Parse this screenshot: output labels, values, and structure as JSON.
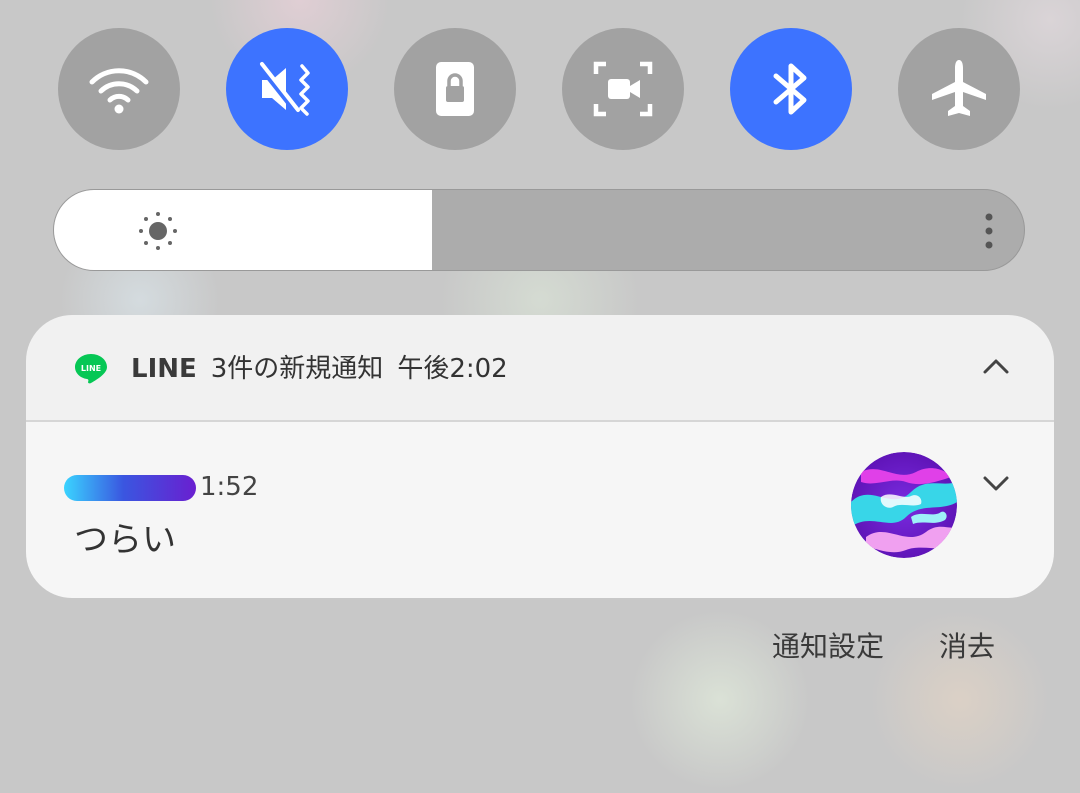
{
  "quick_settings": {
    "tiles": [
      {
        "icon": "wifi-icon",
        "state": "off"
      },
      {
        "icon": "mute-vibrate-icon",
        "state": "on"
      },
      {
        "icon": "screen-lock-icon",
        "state": "off"
      },
      {
        "icon": "screen-recorder-icon",
        "state": "off"
      },
      {
        "icon": "bluetooth-icon",
        "state": "on"
      },
      {
        "icon": "airplane-icon",
        "state": "off"
      }
    ],
    "colors": {
      "on": "#3d73ff",
      "off": "#a2a2a2"
    }
  },
  "brightness": {
    "level": 0.39,
    "icon": "sun-icon",
    "more_icon": "vertical-dots-icon"
  },
  "notification": {
    "app_name": "LINE",
    "summary": "3件の新規通知",
    "time": "午後2:02",
    "app_color": "#06c755",
    "message": {
      "sender_time": "1:52",
      "text": "つらい"
    }
  },
  "actions": {
    "settings_label": "通知設定",
    "clear_label": "消去"
  }
}
